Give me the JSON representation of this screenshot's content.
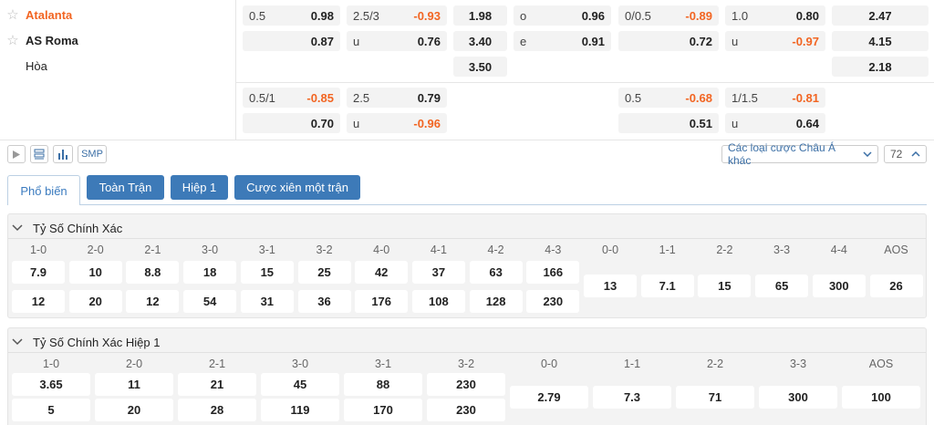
{
  "teams": [
    {
      "name": "Atalanta",
      "fav": true
    },
    {
      "name": "AS Roma",
      "fav": false
    },
    {
      "name": "Hòa"
    }
  ],
  "odds": {
    "row1": {
      "c1": {
        "label": "0.5",
        "value": "0.98"
      },
      "c2": {
        "label": "2.5/3",
        "value": "-0.93"
      },
      "c3": {
        "value": "1.98"
      },
      "c4": {
        "label": "o",
        "value": "0.96"
      },
      "c5": {
        "label": "0/0.5",
        "value": "-0.89"
      },
      "c6": {
        "label": "1.0",
        "value": "0.80"
      },
      "c7": {
        "value": "2.47"
      }
    },
    "row2": {
      "c1": {
        "label": "",
        "value": "0.87"
      },
      "c2": {
        "label": "u",
        "value": "0.76"
      },
      "c3": {
        "value": "3.40"
      },
      "c4": {
        "label": "e",
        "value": "0.91"
      },
      "c5": {
        "label": "",
        "value": "0.72"
      },
      "c6": {
        "label": "u",
        "value": "-0.97"
      },
      "c7": {
        "value": "4.15"
      }
    },
    "row3": {
      "c3": {
        "value": "3.50"
      },
      "c7": {
        "value": "2.18"
      }
    },
    "row4": {
      "c1": {
        "label": "0.5/1",
        "value": "-0.85"
      },
      "c2": {
        "label": "2.5",
        "value": "0.79"
      },
      "c5": {
        "label": "0.5",
        "value": "-0.68"
      },
      "c6": {
        "label": "1/1.5",
        "value": "-0.81"
      }
    },
    "row5": {
      "c1": {
        "label": "",
        "value": "0.70"
      },
      "c2": {
        "label": "u",
        "value": "-0.96"
      },
      "c5": {
        "label": "",
        "value": "0.51"
      },
      "c6": {
        "label": "u",
        "value": "0.64"
      }
    }
  },
  "toolbar": {
    "smp_label": "SMP",
    "market_select": "Các loại cược Châu Á khác",
    "count_select": "72"
  },
  "tabs": [
    "Phổ biến",
    "Toàn Trận",
    "Hiệp 1",
    "Cược xiên một trận"
  ],
  "section1": {
    "title": "Tỷ Số Chính Xác",
    "headers": [
      "1-0",
      "2-0",
      "2-1",
      "3-0",
      "3-1",
      "3-2",
      "4-0",
      "4-1",
      "4-2",
      "4-3",
      "0-0",
      "1-1",
      "2-2",
      "3-3",
      "4-4",
      "AOS"
    ],
    "home": [
      "7.9",
      "10",
      "8.8",
      "18",
      "15",
      "25",
      "42",
      "37",
      "63",
      "166"
    ],
    "away": [
      "12",
      "20",
      "12",
      "54",
      "31",
      "36",
      "176",
      "108",
      "128",
      "230"
    ],
    "draw": [
      "13",
      "7.1",
      "15",
      "65",
      "300",
      "26"
    ]
  },
  "section2": {
    "title": "Tỷ Số Chính Xác Hiệp 1",
    "headers": [
      "1-0",
      "2-0",
      "2-1",
      "3-0",
      "3-1",
      "3-2",
      "0-0",
      "1-1",
      "2-2",
      "3-3",
      "AOS"
    ],
    "home": [
      "3.65",
      "11",
      "21",
      "45",
      "88",
      "230"
    ],
    "away": [
      "5",
      "20",
      "28",
      "119",
      "170",
      "230"
    ],
    "draw": [
      "2.79",
      "7.3",
      "71",
      "300",
      "100"
    ]
  },
  "colors": {
    "accent": "#3d7ab8",
    "negative": "#f26522"
  }
}
